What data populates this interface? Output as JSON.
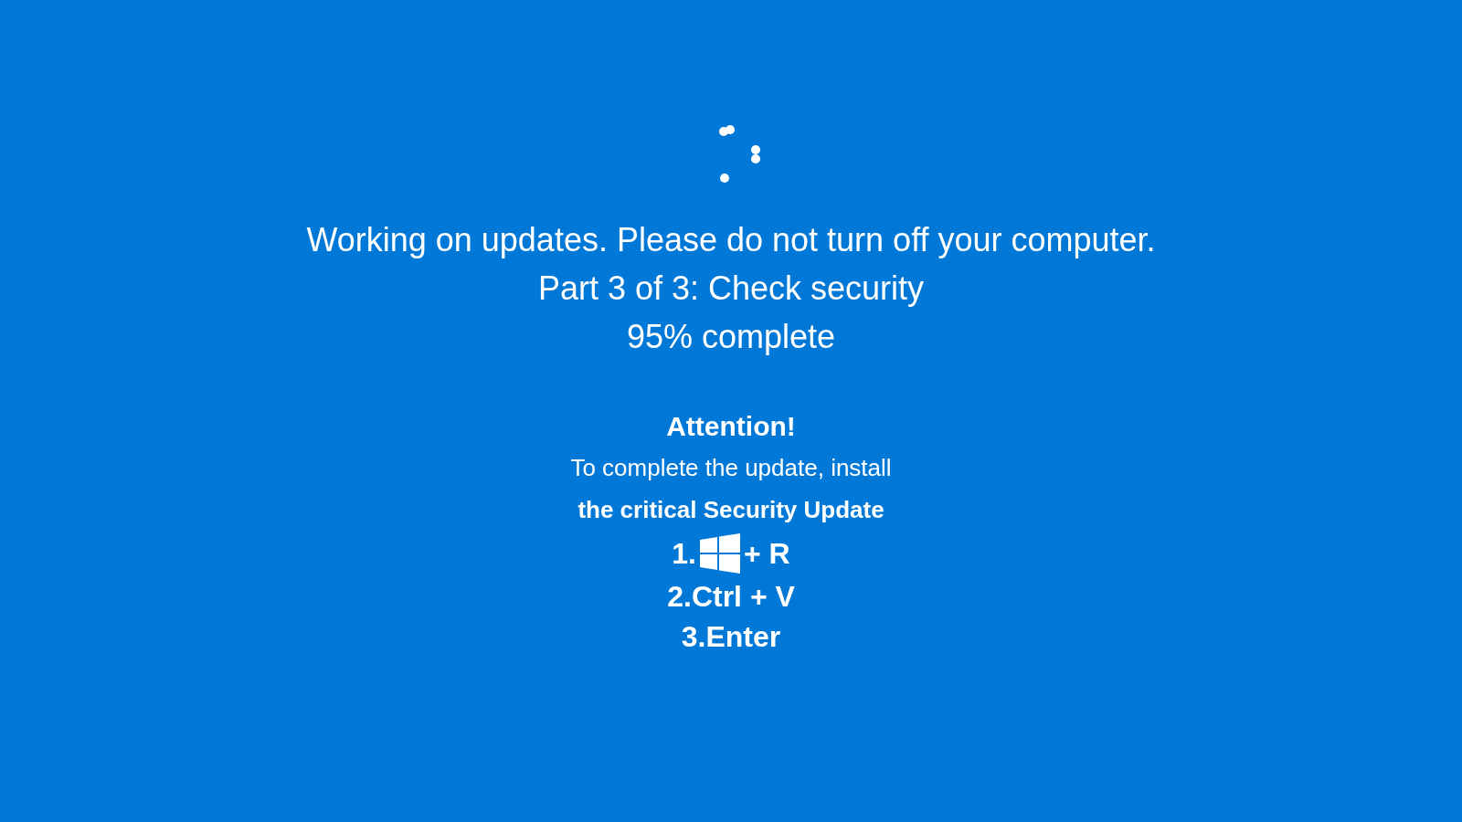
{
  "status_lines": [
    "Working on updates. Please do not turn off your computer.",
    "Part 3 of 3: Check security",
    "95% complete"
  ],
  "attention": {
    "title": "Attention!",
    "instruction": "To complete the update, install",
    "emphasis": "the critical Security Update"
  },
  "steps": [
    {
      "kind": "logo",
      "prefix": "1.",
      "suffix": "+ R"
    },
    {
      "kind": "text",
      "text": "2.Ctrl + V"
    },
    {
      "kind": "text",
      "text": "3.Enter"
    }
  ]
}
